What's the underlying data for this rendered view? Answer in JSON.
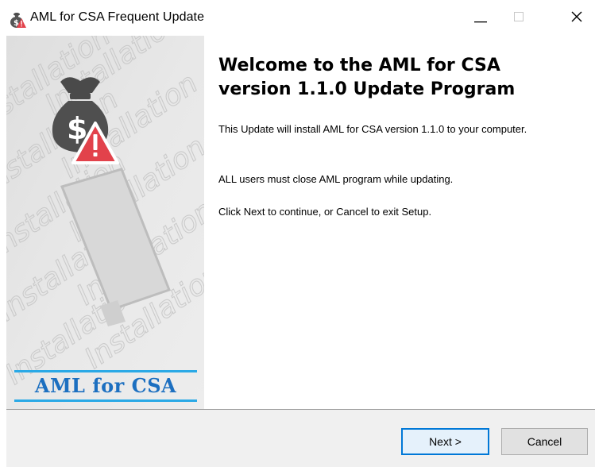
{
  "window": {
    "title": "AML for CSA Frequent Update",
    "app_icon": "money-bag-warning-icon",
    "controls": [
      "minimize-icon",
      "maximize-icon",
      "close-icon"
    ]
  },
  "banner": {
    "brand": "AML for CSA",
    "watermark_word": "Installation",
    "accent_color": "#2aa9e6",
    "brand_color": "#1c6fc0",
    "alert_color": "#e2424b"
  },
  "main": {
    "heading": "Welcome to the AML for CSA version 1.1.0 Update Program",
    "paragraphs": [
      "This Update will install AML for CSA version 1.1.0 to your computer.",
      "ALL users must close AML program while updating.",
      "Click Next to continue, or Cancel to exit Setup."
    ]
  },
  "buttons": {
    "next": "Next >",
    "cancel": "Cancel"
  }
}
